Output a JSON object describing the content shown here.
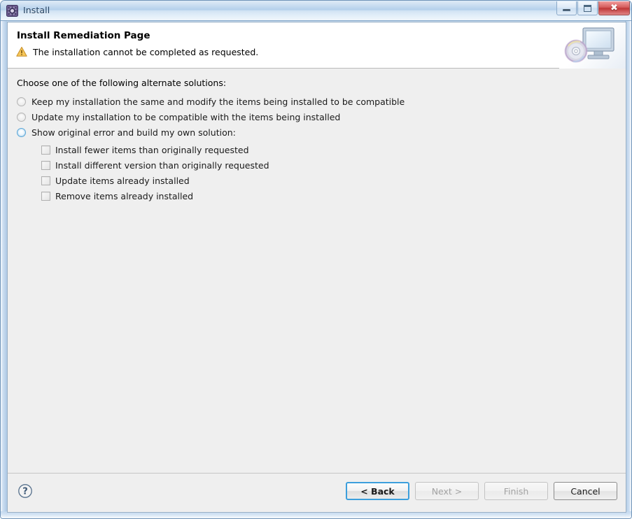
{
  "window": {
    "title": "Install",
    "icon": "install-gear-icon",
    "controls": {
      "minimize_label": "Minimize",
      "maximize_label": "Maximize",
      "close_label": "Close"
    }
  },
  "header": {
    "title": "Install Remediation Page",
    "status_icon": "warning-icon",
    "message": "The installation cannot be completed as requested.",
    "graphic_icon": "monitor-with-disc-icon"
  },
  "body": {
    "intro_label": "Choose one of the following alternate solutions:",
    "radios": [
      {
        "label": "Keep my installation the same and modify the items being installed to be compatible",
        "selected": false,
        "state": "off"
      },
      {
        "label": "Update my installation to be compatible with the items being installed",
        "selected": false,
        "state": "off"
      },
      {
        "label": "Show original error and build my own solution:",
        "selected": true,
        "state": "focus"
      }
    ],
    "checkboxes": [
      {
        "label": "Install fewer items than originally requested",
        "checked": false
      },
      {
        "label": "Install different version than originally requested",
        "checked": false
      },
      {
        "label": "Update items already installed",
        "checked": false
      },
      {
        "label": "Remove items already installed",
        "checked": false
      }
    ]
  },
  "footer": {
    "help_icon": "help-question-icon",
    "buttons": [
      {
        "label": "< Back",
        "state": "default"
      },
      {
        "label": "Next >",
        "state": "disabled"
      },
      {
        "label": "Finish",
        "state": "disabled"
      },
      {
        "label": "Cancel",
        "state": "enabled"
      }
    ]
  },
  "colors": {
    "accent_focus": "#3c9fdc",
    "titlebar": "#a8c8e8",
    "body_background": "#efefef",
    "warning": "#f0b323",
    "close_button": "#bf3636"
  }
}
